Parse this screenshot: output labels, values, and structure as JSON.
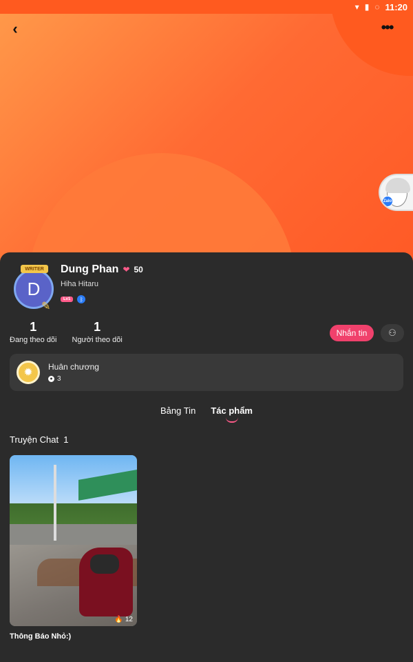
{
  "status_bar": {
    "time": "11:20"
  },
  "profile": {
    "name": "Dung Phan",
    "points": "50",
    "subname": "Hiha Hitaru",
    "avatar_letter": "D",
    "writer_badge": "WRITER",
    "level_badge": "Lv1"
  },
  "stats": {
    "following_count": "1",
    "following_label": "Đang theo dõi",
    "followers_count": "1",
    "followers_label": "Người theo dõi"
  },
  "actions": {
    "message_label": "Nhắn tin"
  },
  "medals": {
    "title": "Huân chương",
    "count": "3"
  },
  "tabs": [
    {
      "label": "Bảng Tin"
    },
    {
      "label": "Tác phẩm"
    }
  ],
  "section": {
    "title": "Truyện Chat",
    "count": "1"
  },
  "works": [
    {
      "title": "Thông Báo Nhỏ:)",
      "likes": "12"
    }
  ],
  "floating": {
    "label": "Zalo"
  },
  "colors": {
    "banner_primary": "#ff6a33",
    "accent_pink": "#f0416c",
    "panel_bg": "#2b2b2b"
  },
  "icons": {
    "back": "chevron-left-icon",
    "more": "more-horizontal-icon",
    "follow": "add-user-icon",
    "heart": "heart-icon",
    "medal": "medal-icon",
    "like": "flame-icon"
  }
}
